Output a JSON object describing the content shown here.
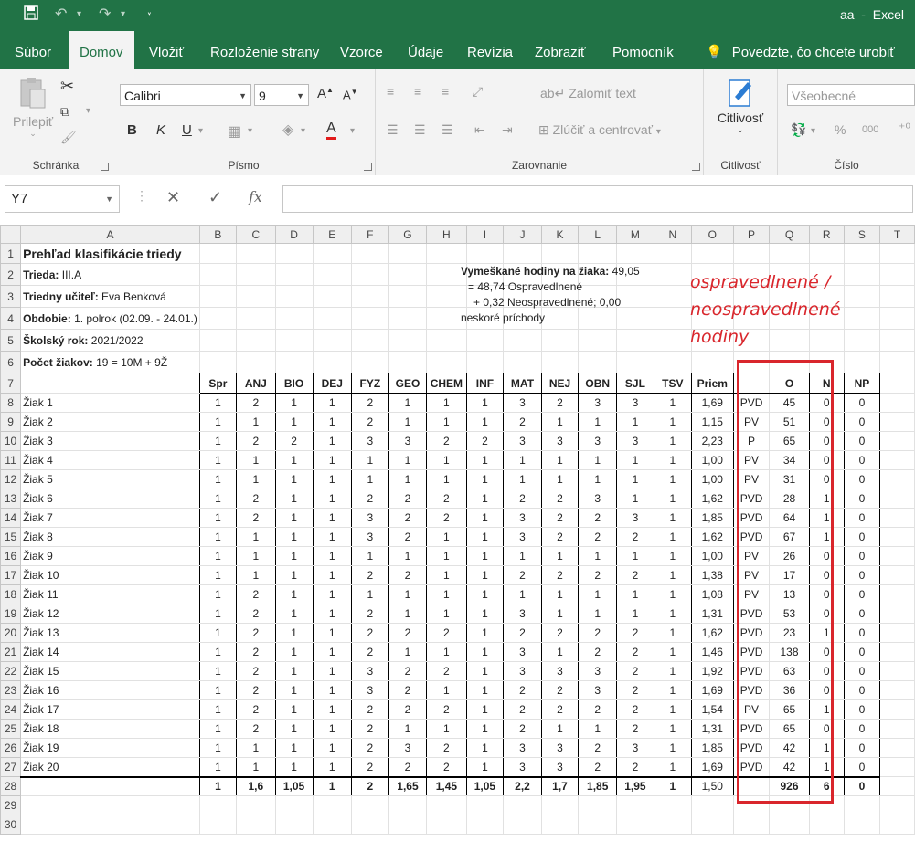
{
  "app": {
    "doc_name": "aa",
    "app_name": "Excel",
    "title_sep": "  -  "
  },
  "tabs": [
    {
      "label": "Súbor",
      "active": false
    },
    {
      "label": "Domov",
      "active": true
    },
    {
      "label": "Vložiť",
      "active": false
    },
    {
      "label": "Rozloženie strany",
      "active": false
    },
    {
      "label": "Vzorce",
      "active": false
    },
    {
      "label": "Údaje",
      "active": false
    },
    {
      "label": "Revízia",
      "active": false
    },
    {
      "label": "Zobraziť",
      "active": false
    },
    {
      "label": "Pomocník",
      "active": false
    }
  ],
  "tellme": "Povedzte, čo chcete urobiť",
  "ribbon": {
    "clipboard": {
      "label": "Schránka",
      "paste": "Prilepiť"
    },
    "font": {
      "label": "Písmo",
      "name": "Calibri",
      "size": "9",
      "bold": "B",
      "italic": "K",
      "underline": "U"
    },
    "align": {
      "label": "Zarovnanie",
      "wrap": "Zalomiť text",
      "merge": "Zlúčiť a centrovať"
    },
    "sensitivity": {
      "label": "Citlivosť",
      "button": "Citlivosť"
    },
    "number": {
      "label": "Číslo",
      "format": "Všeobecné",
      "percent": "%",
      "thousands": "000"
    }
  },
  "formula_bar": {
    "name_box": "Y7",
    "value": "",
    "fx": "fx"
  },
  "columns": [
    "A",
    "B",
    "C",
    "D",
    "E",
    "F",
    "G",
    "H",
    "I",
    "J",
    "K",
    "L",
    "M",
    "N",
    "O",
    "P",
    "Q",
    "R",
    "S",
    "T"
  ],
  "header_info": {
    "title": "Prehľad klasifikácie triedy",
    "lines": [
      {
        "label": "Trieda:",
        "value": "III.A"
      },
      {
        "label": "Triedny učiteľ:",
        "value": "Eva Benková"
      },
      {
        "label": "Obdobie:",
        "value": "1. polrok (02.09. - 24.01.)"
      },
      {
        "label": "Školský rok:",
        "value": "2021/2022"
      },
      {
        "label": "Počet žiakov:",
        "value": "19 = 10M + 9Ž"
      }
    ]
  },
  "absence_note": {
    "label": "Vymeškané hodiny na žiaka:",
    "value": "49,05",
    "line2": "= 48,74 Ospravedlnené",
    "line3": "+ 0,32 Neospravedlnené; 0,00",
    "line4": "neskoré príchody"
  },
  "handwritten_note": [
    "ospravedlnené /",
    "neospravedlnené",
    "hodiny"
  ],
  "table_headers": [
    "Spr",
    "ANJ",
    "BIO",
    "DEJ",
    "FYZ",
    "GEO",
    "CHEM",
    "INF",
    "MAT",
    "NEJ",
    "OBN",
    "SJL",
    "TSV",
    "Priem",
    "",
    "O",
    "N",
    "NP"
  ],
  "students": [
    {
      "name": "Žiak 1",
      "g": [
        "1",
        "2",
        "1",
        "1",
        "2",
        "1",
        "1",
        "1",
        "3",
        "2",
        "3",
        "3",
        "1"
      ],
      "avg": "1,69",
      "res": "PVD",
      "o": "45",
      "n": "0",
      "np": "0"
    },
    {
      "name": "Žiak 2",
      "g": [
        "1",
        "1",
        "1",
        "1",
        "2",
        "1",
        "1",
        "1",
        "2",
        "1",
        "1",
        "1",
        "1"
      ],
      "avg": "1,15",
      "res": "PV",
      "o": "51",
      "n": "0",
      "np": "0"
    },
    {
      "name": "Žiak 3",
      "g": [
        "1",
        "2",
        "2",
        "1",
        "3",
        "3",
        "2",
        "2",
        "3",
        "3",
        "3",
        "3",
        "1"
      ],
      "avg": "2,23",
      "res": "P",
      "o": "65",
      "n": "0",
      "np": "0"
    },
    {
      "name": "Žiak 4",
      "g": [
        "1",
        "1",
        "1",
        "1",
        "1",
        "1",
        "1",
        "1",
        "1",
        "1",
        "1",
        "1",
        "1"
      ],
      "avg": "1,00",
      "res": "PV",
      "o": "34",
      "n": "0",
      "np": "0"
    },
    {
      "name": "Žiak 5",
      "g": [
        "1",
        "1",
        "1",
        "1",
        "1",
        "1",
        "1",
        "1",
        "1",
        "1",
        "1",
        "1",
        "1"
      ],
      "avg": "1,00",
      "res": "PV",
      "o": "31",
      "n": "0",
      "np": "0"
    },
    {
      "name": "Žiak 6",
      "g": [
        "1",
        "2",
        "1",
        "1",
        "2",
        "2",
        "2",
        "1",
        "2",
        "2",
        "3",
        "1",
        "1"
      ],
      "avg": "1,62",
      "res": "PVD",
      "o": "28",
      "n": "1",
      "np": "0"
    },
    {
      "name": "Žiak 7",
      "g": [
        "1",
        "2",
        "1",
        "1",
        "3",
        "2",
        "2",
        "1",
        "3",
        "2",
        "2",
        "3",
        "1"
      ],
      "avg": "1,85",
      "res": "PVD",
      "o": "64",
      "n": "1",
      "np": "0"
    },
    {
      "name": "Žiak 8",
      "g": [
        "1",
        "1",
        "1",
        "1",
        "3",
        "2",
        "1",
        "1",
        "3",
        "2",
        "2",
        "2",
        "1"
      ],
      "avg": "1,62",
      "res": "PVD",
      "o": "67",
      "n": "1",
      "np": "0"
    },
    {
      "name": "Žiak 9",
      "g": [
        "1",
        "1",
        "1",
        "1",
        "1",
        "1",
        "1",
        "1",
        "1",
        "1",
        "1",
        "1",
        "1"
      ],
      "avg": "1,00",
      "res": "PV",
      "o": "26",
      "n": "0",
      "np": "0"
    },
    {
      "name": "Žiak 10",
      "g": [
        "1",
        "1",
        "1",
        "1",
        "2",
        "2",
        "1",
        "1",
        "2",
        "2",
        "2",
        "2",
        "1"
      ],
      "avg": "1,38",
      "res": "PV",
      "o": "17",
      "n": "0",
      "np": "0"
    },
    {
      "name": "Žiak 11",
      "g": [
        "1",
        "2",
        "1",
        "1",
        "1",
        "1",
        "1",
        "1",
        "1",
        "1",
        "1",
        "1",
        "1"
      ],
      "avg": "1,08",
      "res": "PV",
      "o": "13",
      "n": "0",
      "np": "0"
    },
    {
      "name": "Žiak 12",
      "g": [
        "1",
        "2",
        "1",
        "1",
        "2",
        "1",
        "1",
        "1",
        "3",
        "1",
        "1",
        "1",
        "1"
      ],
      "avg": "1,31",
      "res": "PVD",
      "o": "53",
      "n": "0",
      "np": "0"
    },
    {
      "name": "Žiak 13",
      "g": [
        "1",
        "2",
        "1",
        "1",
        "2",
        "2",
        "2",
        "1",
        "2",
        "2",
        "2",
        "2",
        "1"
      ],
      "avg": "1,62",
      "res": "PVD",
      "o": "23",
      "n": "1",
      "np": "0"
    },
    {
      "name": "Žiak 14",
      "g": [
        "1",
        "2",
        "1",
        "1",
        "2",
        "1",
        "1",
        "1",
        "3",
        "1",
        "2",
        "2",
        "1"
      ],
      "avg": "1,46",
      "res": "PVD",
      "o": "138",
      "n": "0",
      "np": "0"
    },
    {
      "name": "Žiak 15",
      "g": [
        "1",
        "2",
        "1",
        "1",
        "3",
        "2",
        "2",
        "1",
        "3",
        "3",
        "3",
        "2",
        "1"
      ],
      "avg": "1,92",
      "res": "PVD",
      "o": "63",
      "n": "0",
      "np": "0"
    },
    {
      "name": "Žiak 16",
      "g": [
        "1",
        "2",
        "1",
        "1",
        "3",
        "2",
        "1",
        "1",
        "2",
        "2",
        "3",
        "2",
        "1"
      ],
      "avg": "1,69",
      "res": "PVD",
      "o": "36",
      "n": "0",
      "np": "0"
    },
    {
      "name": "Žiak 17",
      "g": [
        "1",
        "2",
        "1",
        "1",
        "2",
        "2",
        "2",
        "1",
        "2",
        "2",
        "2",
        "2",
        "1"
      ],
      "avg": "1,54",
      "res": "PV",
      "o": "65",
      "n": "1",
      "np": "0"
    },
    {
      "name": "Žiak 18",
      "g": [
        "1",
        "2",
        "1",
        "1",
        "2",
        "1",
        "1",
        "1",
        "2",
        "1",
        "1",
        "2",
        "1"
      ],
      "avg": "1,31",
      "res": "PVD",
      "o": "65",
      "n": "0",
      "np": "0"
    },
    {
      "name": "Žiak 19",
      "g": [
        "1",
        "1",
        "1",
        "1",
        "2",
        "3",
        "2",
        "1",
        "3",
        "3",
        "2",
        "3",
        "1"
      ],
      "avg": "1,85",
      "res": "PVD",
      "o": "42",
      "n": "1",
      "np": "0"
    },
    {
      "name": "Žiak 20",
      "g": [
        "1",
        "1",
        "1",
        "1",
        "2",
        "2",
        "2",
        "1",
        "3",
        "3",
        "2",
        "2",
        "1"
      ],
      "avg": "1,69",
      "res": "PVD",
      "o": "42",
      "n": "1",
      "np": "0"
    }
  ],
  "totals": {
    "g": [
      "1",
      "1,6",
      "1,05",
      "1",
      "2",
      "1,65",
      "1,45",
      "1,05",
      "2,2",
      "1,7",
      "1,85",
      "1,95",
      "1"
    ],
    "avg": "1,50",
    "res": "",
    "o": "926",
    "n": "6",
    "np": "0"
  },
  "row_numbers": [
    "1",
    "2",
    "3",
    "4",
    "5",
    "6",
    "7",
    "8",
    "9",
    "10",
    "11",
    "12",
    "13",
    "14",
    "15",
    "16",
    "17",
    "18",
    "19",
    "20",
    "21",
    "22",
    "23",
    "24",
    "25",
    "26",
    "27",
    "28",
    "29",
    "30"
  ],
  "accent": "#217346",
  "annotation_color": "#d9262c"
}
